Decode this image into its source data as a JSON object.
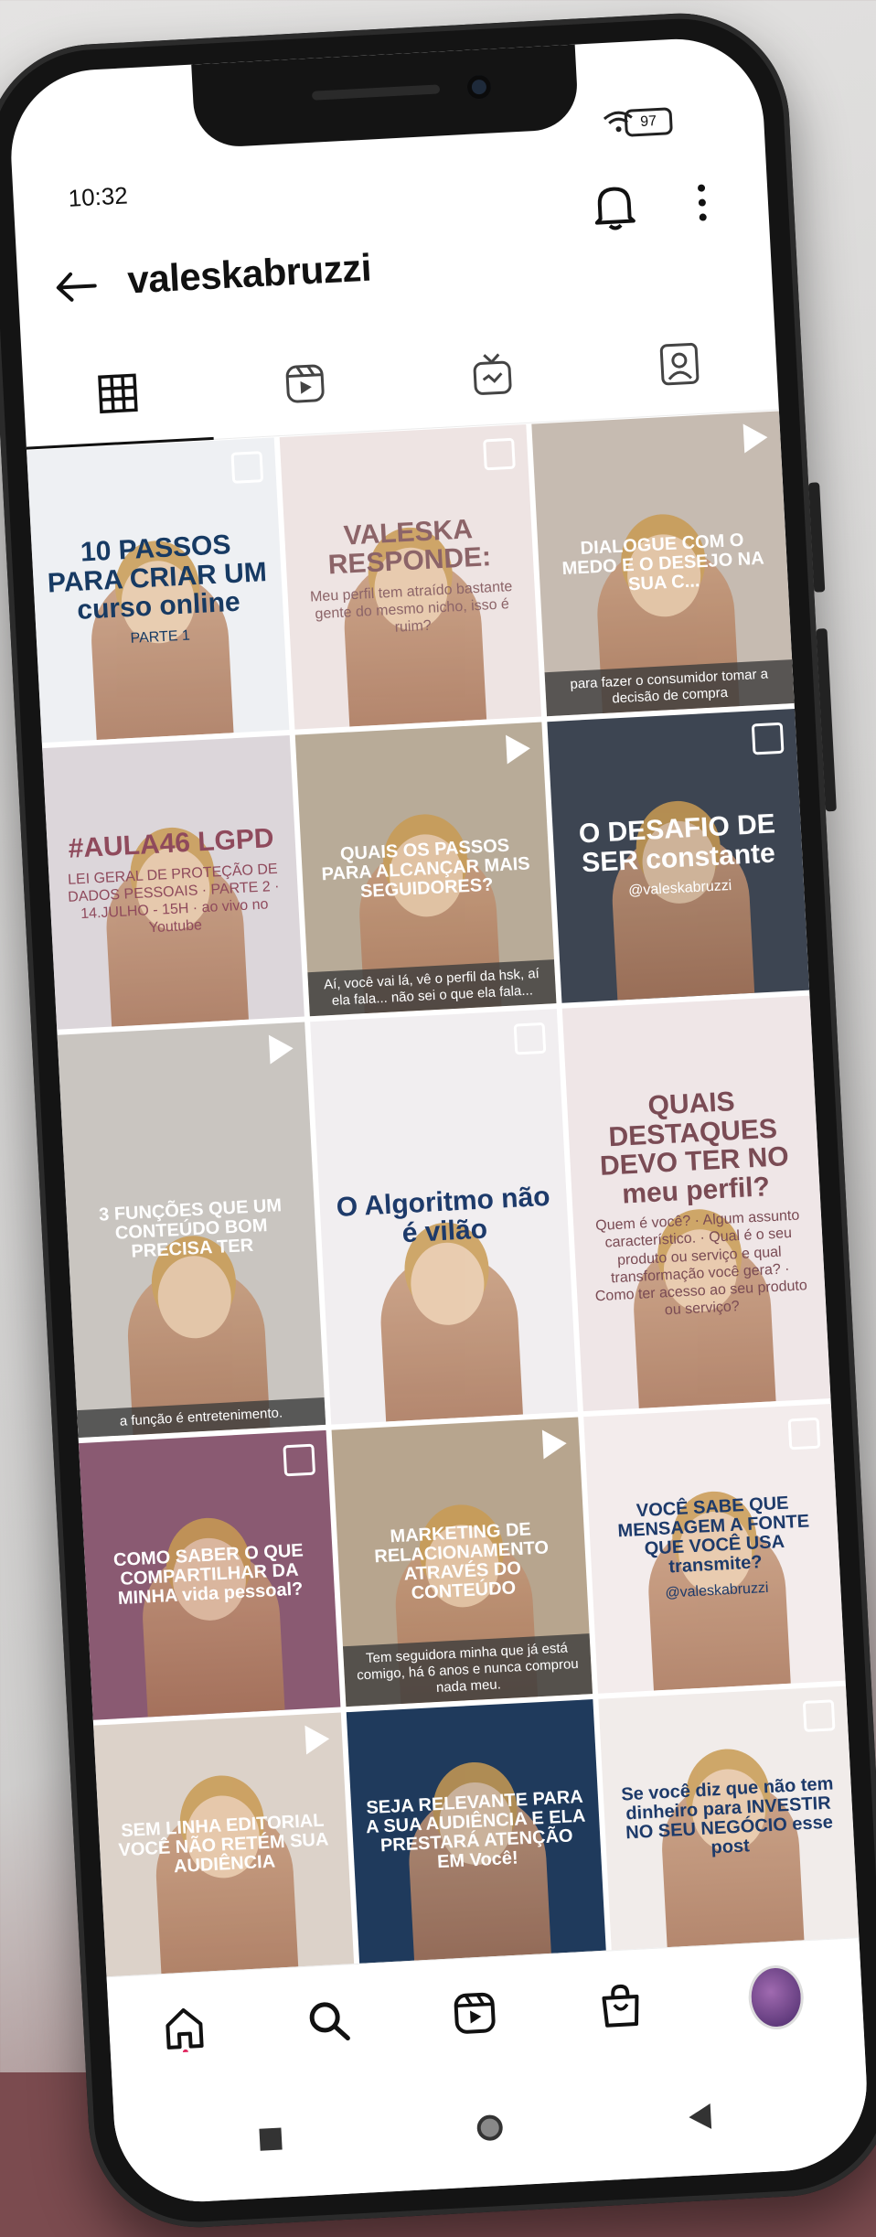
{
  "status_bar": {
    "time": "10:32",
    "battery": "97"
  },
  "header": {
    "username": "valeskabruzzi"
  },
  "tabs": [
    {
      "name": "grid",
      "icon": "grid-icon"
    },
    {
      "name": "reels",
      "icon": "reels-icon"
    },
    {
      "name": "igtv",
      "icon": "igtv-icon"
    },
    {
      "name": "tagged",
      "icon": "tagged-icon"
    }
  ],
  "posts": [
    {
      "main": "10 PASSOS PARA CRIAR UM curso online",
      "sub": "PARTE 1",
      "cap": "",
      "bg": "#eef0f3",
      "fg": "#173a63",
      "badge": "multi"
    },
    {
      "main": "VALESKA RESPONDE:",
      "sub": "Meu perfil tem atraído bastante gente do mesmo nicho, isso é ruim?",
      "cap": "",
      "bg": "#eee4e3",
      "fg": "#8c6468",
      "badge": "multi"
    },
    {
      "main": "DIALOGUE COM O MEDO E O DESEJO NA SUA C...",
      "sub": "",
      "cap": "para fazer o consumidor tomar a decisão de compra",
      "bg": "#c6bbb1",
      "fg": "#ffffff",
      "badge": "reel"
    },
    {
      "main": "#AULA46 LGPD",
      "sub": "LEI GERAL DE PROTEÇÃO DE DADOS PESSOAIS · PARTE 2 · 14.JULHO - 15H · ao vivo no Youtube",
      "cap": "",
      "bg": "#dcd6da",
      "fg": "#8f4a5c",
      "badge": ""
    },
    {
      "main": "QUAIS OS PASSOS PARA ALCANÇAR MAIS SEGUIDORES?",
      "sub": "",
      "cap": "Aí, você vai lá, vê o perfil da hsk, aí ela fala... não sei o que ela fala...",
      "bg": "#b8ab98",
      "fg": "#ffffff",
      "badge": "reel"
    },
    {
      "main": "O DESAFIO DE SER constante",
      "sub": "@valeskabruzzi",
      "cap": "",
      "bg": "#3d4552",
      "fg": "#ffffff",
      "badge": "multi"
    },
    {
      "main": "3 FUNÇÕES QUE UM CONTEÚDO BOM PRECISA TER",
      "sub": "",
      "cap": "a função é entretenimento.",
      "bg": "#c9c5c0",
      "fg": "#ffffff",
      "badge": "reel"
    },
    {
      "main": "O Algoritmo não é vilão",
      "sub": "",
      "cap": "",
      "bg": "#f1eef0",
      "fg": "#1d3a6a",
      "badge": "multi"
    },
    {
      "main": "QUAIS DESTAQUES DEVO TER NO meu perfil?",
      "sub": "Quem é você? · Algum assunto característico. · Qual é o seu produto ou serviço e qual transformação você gera? · Como ter acesso ao seu produto ou serviço?",
      "cap": "",
      "bg": "#efe6e7",
      "fg": "#7a4b54",
      "badge": ""
    },
    {
      "main": "COMO SABER O QUE COMPARTILHAR DA MINHA vida pessoal?",
      "sub": "",
      "cap": "",
      "bg": "#8a5a72",
      "fg": "#ffffff",
      "badge": "multi"
    },
    {
      "main": "MARKETING DE RELACIONAMENTO ATRAVÉS DO CONTEÚDO",
      "sub": "",
      "cap": "Tem seguidora minha que já está comigo, há 6 anos e nunca comprou nada meu.",
      "bg": "#b7a58e",
      "fg": "#ffffff",
      "badge": "reel"
    },
    {
      "main": "VOCÊ SABE QUE MENSAGEM A FONTE QUE VOCÊ USA transmite?",
      "sub": "@valeskabruzzi",
      "cap": "",
      "bg": "#f3ecec",
      "fg": "#1d3a6a",
      "badge": "multi"
    },
    {
      "main": "SEM LINHA EDITORIAL VOCÊ NÃO RETÉM SUA AUDIÊNCIA",
      "sub": "",
      "cap": "",
      "bg": "#dcd2c9",
      "fg": "#ffffff",
      "badge": "reel"
    },
    {
      "main": "SEJA RELEVANTE PARA A SUA AUDIÊNCIA E ELA PRESTARÁ ATENÇÃO EM Você!",
      "sub": "",
      "cap": "",
      "bg": "#1f3a5c",
      "fg": "#ffffff",
      "badge": ""
    },
    {
      "main": "Se você diz que não tem dinheiro para INVESTIR NO SEU NEGÓCIO esse post",
      "sub": "",
      "cap": "",
      "bg": "#f1ecea",
      "fg": "#1d3a6a",
      "badge": "multi"
    }
  ],
  "bottom_nav": [
    {
      "name": "home",
      "icon": "home-icon"
    },
    {
      "name": "search",
      "icon": "search-icon"
    },
    {
      "name": "reels",
      "icon": "reels-icon"
    },
    {
      "name": "shop",
      "icon": "shop-icon"
    },
    {
      "name": "profile",
      "icon": "avatar"
    }
  ],
  "system_nav": [
    {
      "name": "recents",
      "icon": "square-icon"
    },
    {
      "name": "home",
      "icon": "circle-icon"
    },
    {
      "name": "back",
      "icon": "triangle-back-icon"
    }
  ]
}
